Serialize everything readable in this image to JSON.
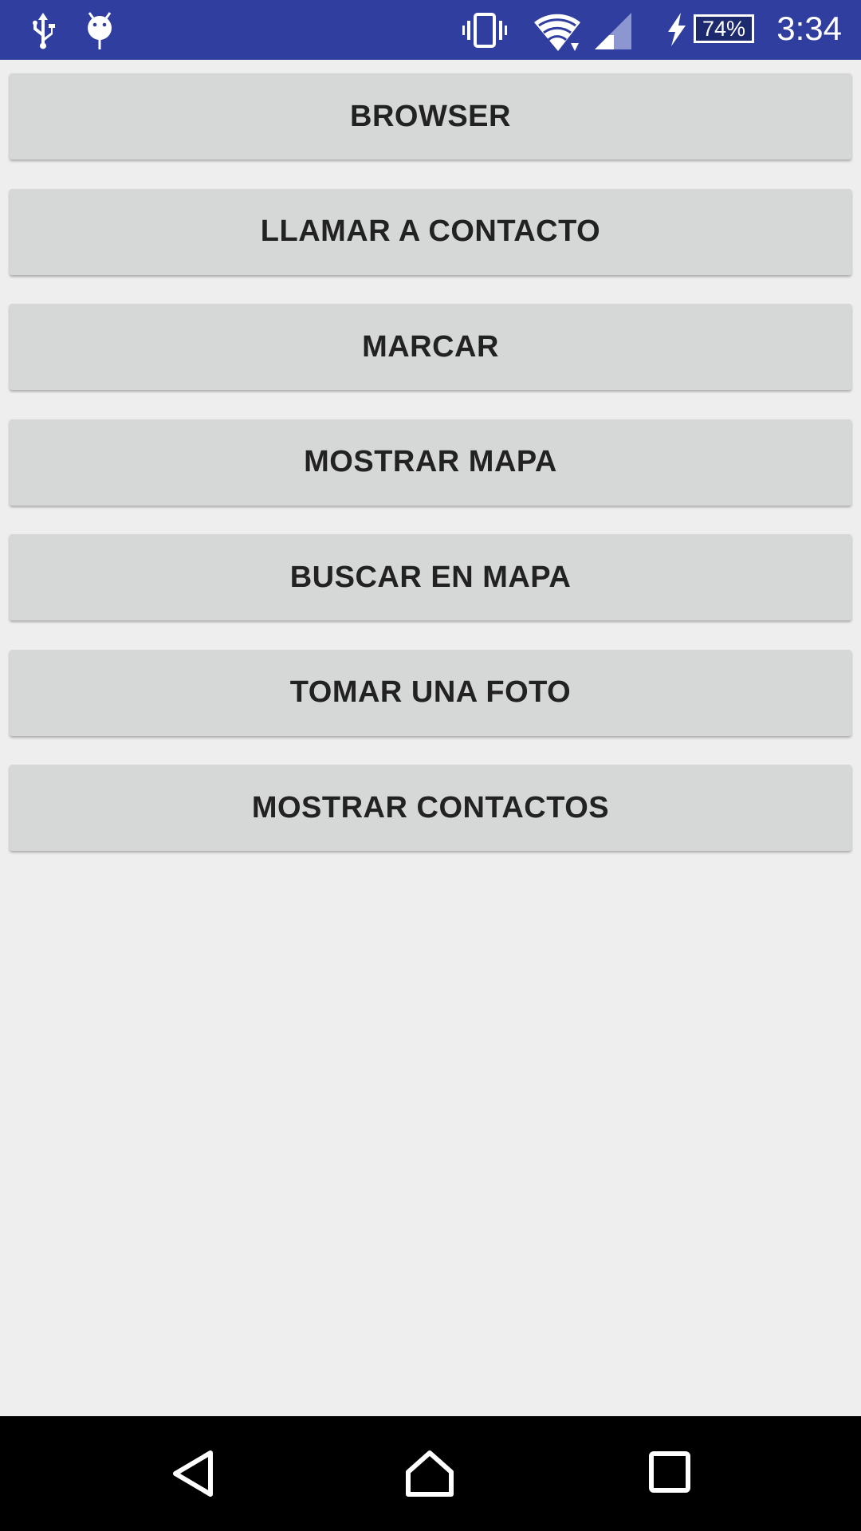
{
  "status_bar": {
    "time": "3:34",
    "battery_percent": "74%",
    "background_color": "#303f9f",
    "icons": [
      "usb-icon",
      "android-debug-icon",
      "vibrate-icon",
      "wifi-icon",
      "cell-signal-icon",
      "charging-icon",
      "battery-icon"
    ]
  },
  "buttons": [
    {
      "label": "BROWSER"
    },
    {
      "label": "LLAMAR A CONTACTO"
    },
    {
      "label": "MARCAR"
    },
    {
      "label": "MOSTRAR MAPA"
    },
    {
      "label": "BUSCAR EN MAPA"
    },
    {
      "label": "TOMAR UNA FOTO"
    },
    {
      "label": "MOSTRAR CONTACTOS"
    }
  ],
  "nav_bar": {
    "icons": [
      "back-icon",
      "home-icon",
      "recents-icon"
    ]
  }
}
